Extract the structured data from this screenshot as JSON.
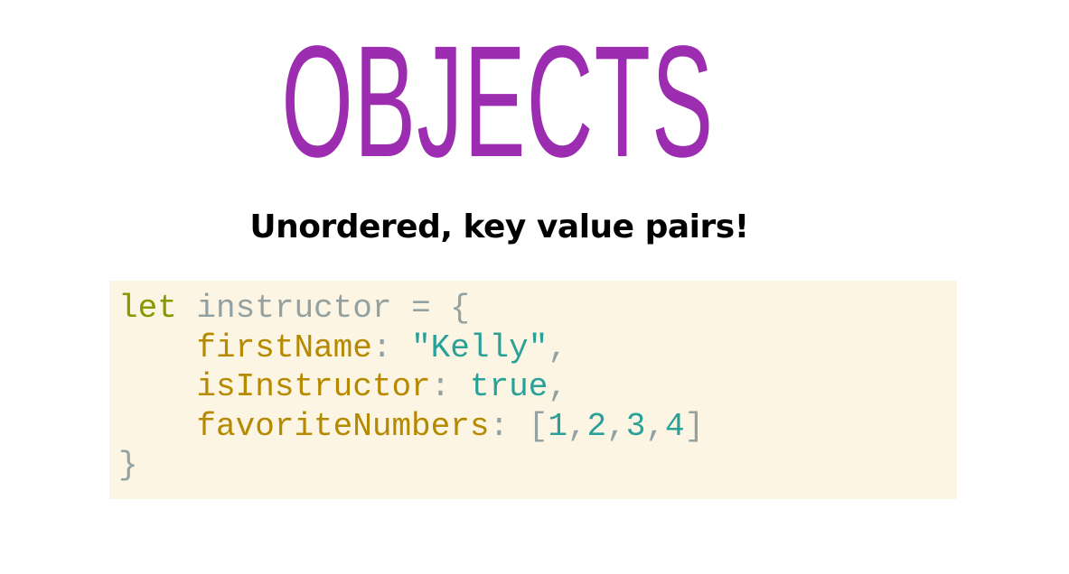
{
  "slide": {
    "title": "OBJECTS",
    "subtitle": "Unordered, key value pairs!"
  },
  "code": {
    "line1": {
      "keyword": "let",
      "identifier": "instructor",
      "operator": "=",
      "brace_open": "{"
    },
    "line2": {
      "key": "firstName",
      "colon": ":",
      "value": "\"Kelly\"",
      "comma": ","
    },
    "line3": {
      "key": "isInstructor",
      "colon": ":",
      "value": "true",
      "comma": ","
    },
    "line4": {
      "key": "favoriteNumbers",
      "colon": ":",
      "bracket_open": "[",
      "values": [
        "1",
        "2",
        "3",
        "4"
      ],
      "separator": ",",
      "bracket_close": "]"
    },
    "line5": {
      "brace_close": "}"
    }
  },
  "colors": {
    "title": "#9c2db0",
    "code_background": "#fcf5e3",
    "keyword": "#859900",
    "property": "#b58900",
    "value": "#2aa198",
    "punctuation": "#93a1a1"
  }
}
